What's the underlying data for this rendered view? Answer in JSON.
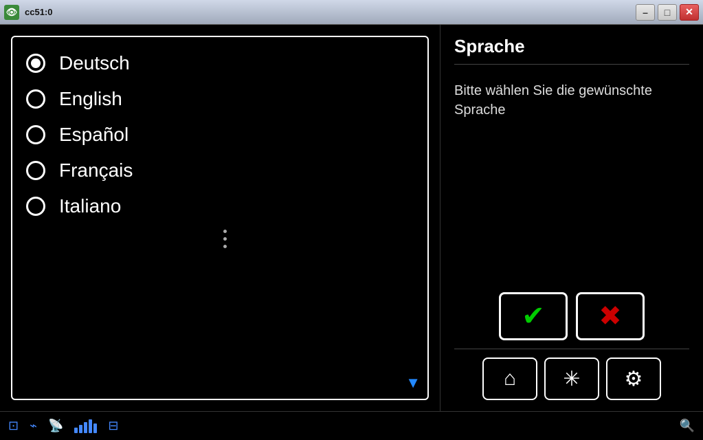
{
  "titlebar": {
    "icon_text": "👁",
    "title": "cc51:0",
    "minimize_label": "–",
    "maximize_label": "□",
    "close_label": "✕"
  },
  "left_panel": {
    "languages": [
      {
        "id": "deutsch",
        "label": "Deutsch",
        "selected": true
      },
      {
        "id": "english",
        "label": "English",
        "selected": false
      },
      {
        "id": "espanol",
        "label": "Español",
        "selected": false
      },
      {
        "id": "francais",
        "label": "Français",
        "selected": false
      },
      {
        "id": "italiano",
        "label": "Italiano",
        "selected": false
      }
    ]
  },
  "right_panel": {
    "title": "Sprache",
    "description": "Bitte wählen Sie die gewünschte Sprache",
    "confirm_label": "✓",
    "cancel_label": "✗"
  },
  "bottom_nav": {
    "home_icon": "⌂",
    "fan_icon": "❄",
    "settings_icon": "⚙"
  },
  "status_bar": {
    "signal_bars": [
      8,
      12,
      16,
      20,
      14
    ],
    "network_icon": "⊟"
  }
}
